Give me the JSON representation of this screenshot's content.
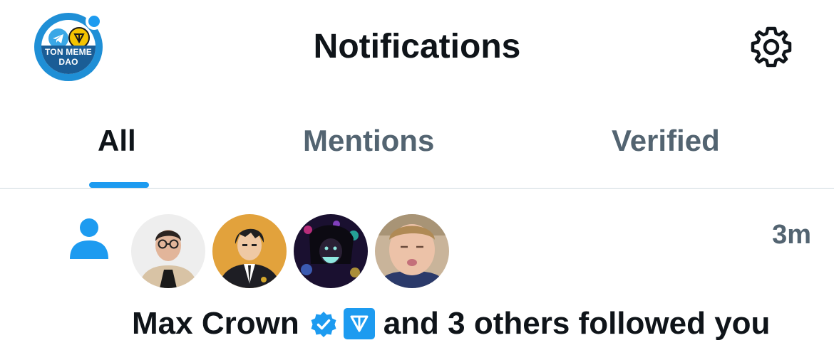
{
  "header": {
    "account_avatar": {
      "brand_line_1": "TON MEME",
      "brand_line_2": "DAO",
      "has_unread_dot": true
    },
    "title": "Notifications",
    "settings_icon": "gear-icon"
  },
  "tabs": [
    {
      "label": "All",
      "active": true
    },
    {
      "label": "Mentions",
      "active": false
    },
    {
      "label": "Verified",
      "active": false
    }
  ],
  "notification": {
    "icon": "person-icon",
    "time": "3m",
    "actor_name": "Max Crown",
    "badges": [
      "verified-badge",
      "ton-badge"
    ],
    "action_text": "and 3 others followed you",
    "follower_avatars": [
      "avatar-1",
      "avatar-2",
      "avatar-3",
      "avatar-4"
    ]
  },
  "colors": {
    "accent": "#1d9bf0",
    "text_primary": "#0f1419",
    "text_secondary": "#536471",
    "divider": "#cfd9de"
  }
}
